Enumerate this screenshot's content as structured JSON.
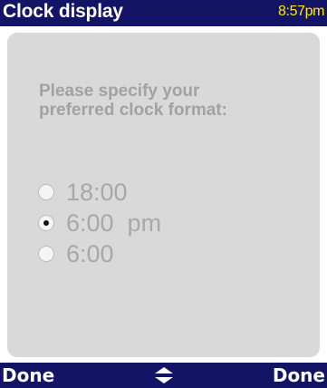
{
  "title_bar": {
    "title": "Clock display",
    "time": "8:57pm"
  },
  "content": {
    "prompt_line1": "Please specify your",
    "prompt_line2": "preferred clock format:",
    "options": [
      {
        "label": "18:00",
        "selected": false
      },
      {
        "label": "6:00  pm",
        "selected": true
      },
      {
        "label": "6:00",
        "selected": false
      }
    ]
  },
  "softkeys": {
    "left": "Done",
    "center_icon": "up-down-arrows-icon",
    "right": "Done"
  },
  "colors": {
    "title_bar_bg": "#141466",
    "clock_text": "#ffe800",
    "panel_bg": "#d9d9d9",
    "muted_text": "#a2a2a2"
  }
}
